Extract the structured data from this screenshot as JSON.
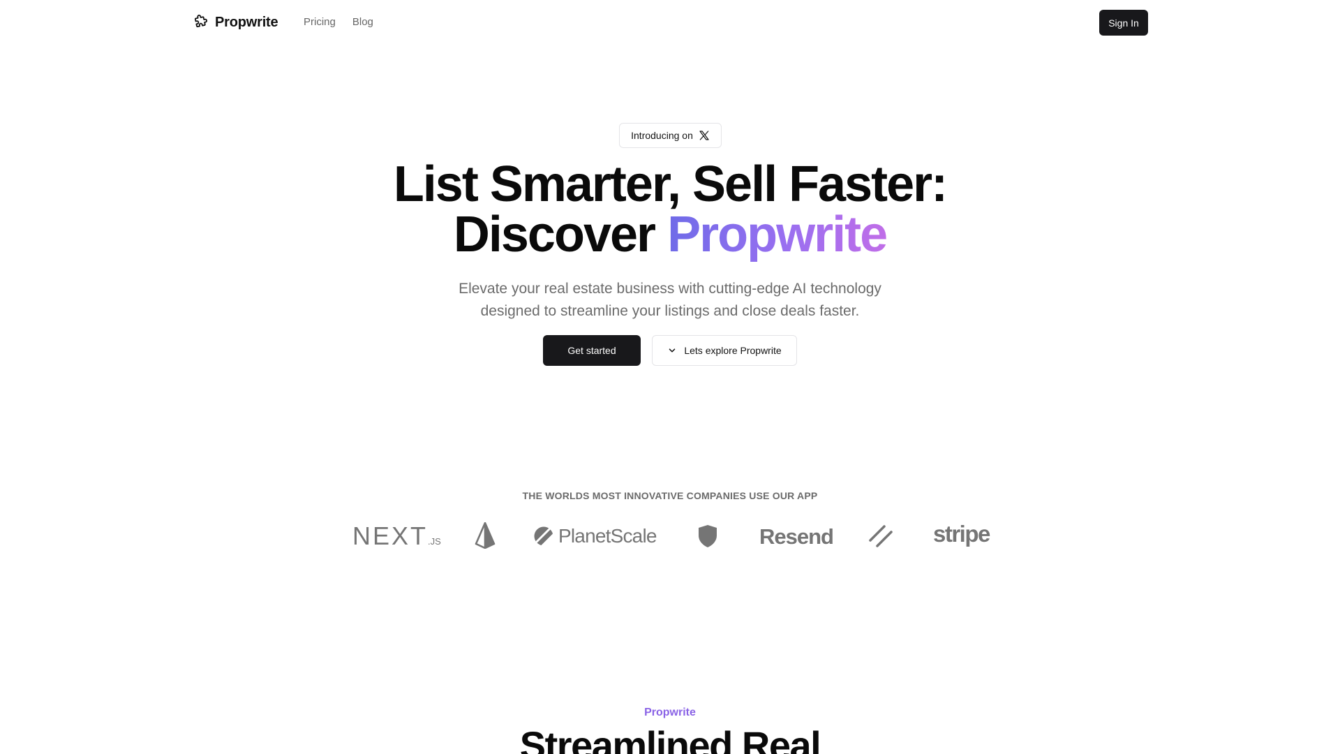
{
  "nav": {
    "brand": "Propwrite",
    "links": [
      "Pricing",
      "Blog"
    ],
    "signin_label": "Sign In"
  },
  "hero": {
    "pill_label": "Introducing on",
    "pill_icon": "x-logo-icon",
    "title_line1": "List Smarter, Sell Faster:",
    "title_line2_plain": "Discover ",
    "title_line2_accent": "Propwrite",
    "subtitle_line1": "Elevate your real estate business with cutting-edge AI technology",
    "subtitle_line2": "designed to streamline your listings and close deals faster.",
    "primary_cta": "Get started",
    "secondary_cta": "Lets explore Propwrite",
    "accent_gradient": [
      "#6f6be8",
      "#9a6ff0",
      "#c06ee8"
    ]
  },
  "logos": {
    "heading": "THE WORLDS MOST INNOVATIVE COMPANIES USE OUR APP",
    "next_main": "NEXT",
    "next_suffix": ".JS",
    "planetscale": "PlanetScale",
    "resend": "Resend",
    "stripe": "stripe"
  },
  "section": {
    "eyebrow": "Propwrite",
    "title": "Streamlined Real"
  }
}
